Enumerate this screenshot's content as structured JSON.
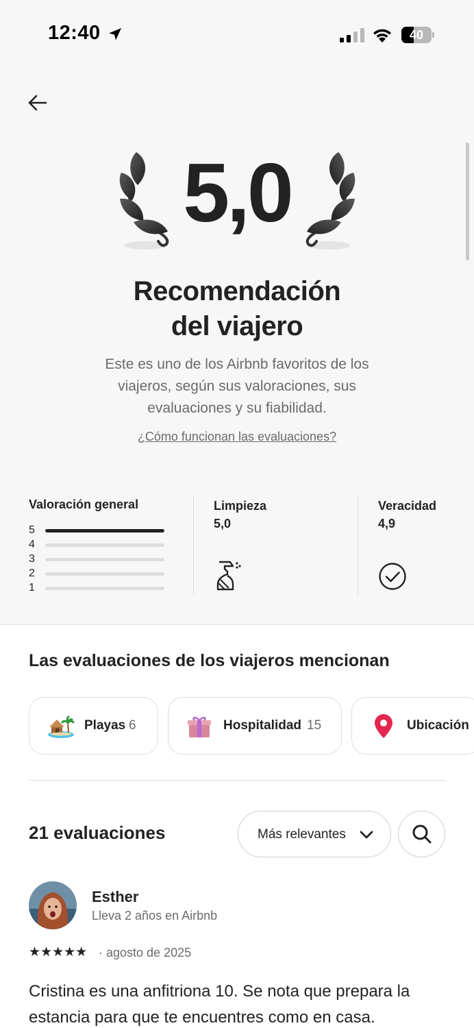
{
  "status_bar": {
    "time": "12:40",
    "battery": "40",
    "battery_level": 0.4
  },
  "hero": {
    "score": "5,0",
    "title_line1": "Recomendación",
    "title_line2": "del viajero",
    "subtitle": "Este es uno de los Airbnb favoritos de los viajeros, según sus valoraciones, sus evaluaciones y su fiabilidad.",
    "link": "¿Cómo funcionan las evaluaciones?"
  },
  "ratings": {
    "overall_label": "Valoración general",
    "distribution": [
      {
        "stars": "5",
        "fraction": 1.0
      },
      {
        "stars": "4",
        "fraction": 0
      },
      {
        "stars": "3",
        "fraction": 0
      },
      {
        "stars": "2",
        "fraction": 0
      },
      {
        "stars": "1",
        "fraction": 0
      }
    ],
    "categories": [
      {
        "label": "Limpieza",
        "value": "5,0",
        "icon": "spray-bottle-icon"
      },
      {
        "label": "Veracidad",
        "value": "4,9",
        "icon": "check-circle-icon"
      }
    ]
  },
  "mentions": {
    "title": "Las evaluaciones de los viajeros mencionan",
    "chips": [
      {
        "label": "Playas",
        "count": "6",
        "icon": "beach-hut-icon"
      },
      {
        "label": "Hospitalidad",
        "count": "15",
        "icon": "gift-icon"
      },
      {
        "label": "Ubicación",
        "count": "",
        "icon": "location-pin-icon"
      }
    ]
  },
  "reviews": {
    "count_label": "21 evaluaciones",
    "sort_label": "Más relevantes",
    "items": [
      {
        "name": "Esther",
        "meta": "Lleva 2 años en Airbnb",
        "stars": "★★★★★",
        "rating": 5,
        "date": "· agosto de 2025",
        "text": "Cristina es una anfitriona 10. Se nota que prepara la estancia para que te encuentres como en casa."
      }
    ]
  },
  "colors": {
    "text": "#222222",
    "muted": "#6a6a6a",
    "pin": "#e5264f",
    "background_top": "#f7f7f7"
  }
}
